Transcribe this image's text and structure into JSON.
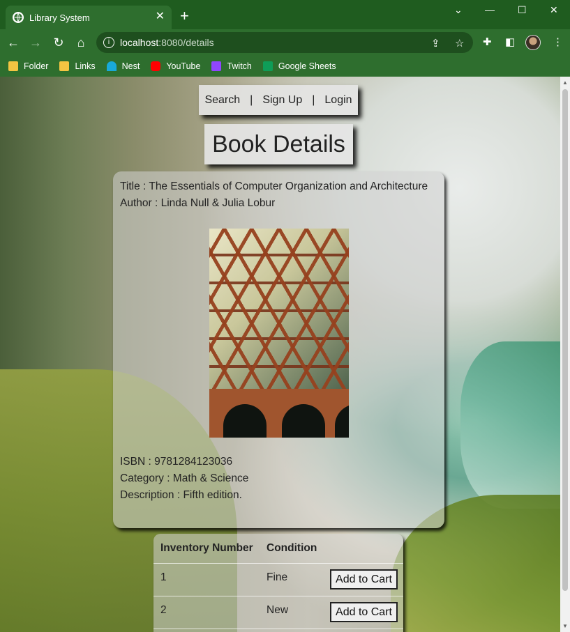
{
  "browser": {
    "tab_title": "Library System",
    "tab_close": "✕",
    "new_tab": "+",
    "url_host": "localhost",
    "url_rest": ":8080/details",
    "window_controls": [
      "⌄",
      "—",
      "☐",
      "✕"
    ],
    "bookmarks": [
      {
        "label": "Folder",
        "icon": "folder-icon",
        "color": "#f4c542"
      },
      {
        "label": "Links",
        "icon": "folder-icon",
        "color": "#f4c542"
      },
      {
        "label": "Nest",
        "icon": "nest-icon",
        "color": "#18a9d8"
      },
      {
        "label": "YouTube",
        "icon": "youtube-icon",
        "color": "#ff0000"
      },
      {
        "label": "Twitch",
        "icon": "twitch-icon",
        "color": "#9146ff"
      },
      {
        "label": "Google Sheets",
        "icon": "sheets-icon",
        "color": "#0f9d58"
      }
    ]
  },
  "nav": {
    "search": "Search",
    "sep1": "|",
    "signup": "Sign Up",
    "sep2": "|",
    "login": "Login"
  },
  "page": {
    "heading": "Book Details"
  },
  "book": {
    "title_line": "Title : The Essentials of Computer Organization and Architecture",
    "author_line": "Author : Linda Null & Julia Lobur",
    "isbn_line": "ISBN : 9781284123036",
    "category_line": "Category : Math & Science",
    "description_line": "Description : Fifth edition."
  },
  "inventory": {
    "headers": [
      "Inventory Number",
      "Condition"
    ],
    "rows": [
      {
        "number": "1",
        "condition": "Fine",
        "action": "Add to Cart"
      },
      {
        "number": "2",
        "condition": "New",
        "action": "Add to Cart"
      }
    ]
  }
}
